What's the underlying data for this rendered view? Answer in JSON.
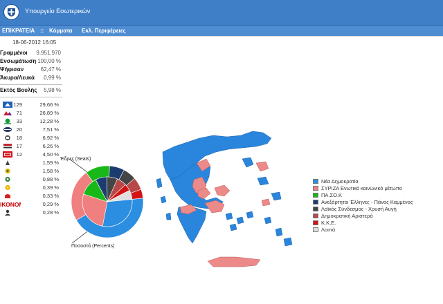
{
  "header": {
    "title": "Υπουργείο Εσωτερικών"
  },
  "nav": {
    "epikrateia": "ΕΠΙΚΡΑΤΕΙΑ",
    "separator": "::",
    "komma": "Κόμματα",
    "perifereies": "Εκλ. Περιφέρειες"
  },
  "timestamp": "18-06-2012 16:05",
  "stats": [
    {
      "label": "Γραμμένοι",
      "value": "9.951.970"
    },
    {
      "label": "Ενσωμάτωση",
      "value": "100,00 %"
    },
    {
      "label": "Ψήφισαν",
      "value": "62,47 %"
    },
    {
      "label": "Άκυρα/Λευκά",
      "value": "0,99 %"
    }
  ],
  "outside": {
    "label": "Εκτός Βουλής",
    "value": "5,98 %"
  },
  "parties": [
    {
      "logo": "nd-logo",
      "seats": "129",
      "pct": "29,66 %",
      "color": "#3b8fd9"
    },
    {
      "logo": "syriza-logo",
      "seats": "71",
      "pct": "26,89 %",
      "color": "#e46f74"
    },
    {
      "logo": "pasok-logo",
      "seats": "33",
      "pct": "12,28 %",
      "color": "#1a9a3a"
    },
    {
      "logo": "anel-logo",
      "seats": "20",
      "pct": "7,51 %",
      "color": "#2a3f6a"
    },
    {
      "logo": "xa-logo",
      "seats": "18",
      "pct": "6,92 %",
      "color": "#444444"
    },
    {
      "logo": "dimar-logo",
      "seats": "17",
      "pct": "6,26 %",
      "color": "#c0272d"
    },
    {
      "logo": "kke-logo",
      "seats": "12",
      "pct": "4,50 %",
      "color": "#d3101b"
    },
    {
      "logo": "party8-logo",
      "seats": "",
      "pct": "1,59 %",
      "color": "#444444"
    },
    {
      "logo": "party9-logo",
      "seats": "",
      "pct": "1,58 %",
      "color": "#e0a800"
    },
    {
      "logo": "party10-logo",
      "seats": "",
      "pct": "0,88 %",
      "color": "#2d7a3a"
    },
    {
      "logo": "party11-logo",
      "seats": "",
      "pct": "0,39 %",
      "color": "#f0b000"
    },
    {
      "logo": "party12-logo",
      "seats": "",
      "pct": "0,33 %",
      "color": "#d62020"
    },
    {
      "logo": "party13-logo",
      "seats": "",
      "pct": "0,29 %",
      "color": "#cc0000"
    },
    {
      "logo": "party14-logo",
      "seats": "",
      "pct": "0,28 %",
      "color": "#333333"
    }
  ],
  "party13_logo_text": "ΙΚΟΝΟΜΙΑ",
  "pie": {
    "seats_label": "Έδρες (Seats)",
    "percent_label": "Ποσοστά (Percents)"
  },
  "legend": [
    {
      "label": "Νέα Δημοκρατία",
      "color": "#2c8ee0"
    },
    {
      "label": "ΣΥΡΙΖΑ Ενωτικό κοινωνικό μέτωπο",
      "color": "#f08080"
    },
    {
      "label": "ΠΑ.ΣΟ.Κ",
      "color": "#18b818"
    },
    {
      "label": "Ανεξάρτητοι Έλληνες - Πάνος Καμμένος",
      "color": "#1c3c70"
    },
    {
      "label": "Λαϊκός Σύνδεσμος - Χρυσή Αυγή",
      "color": "#454545"
    },
    {
      "label": "Δημοκρατική Αριστερά",
      "color": "#b84848"
    },
    {
      "label": "Κ.Κ.Ε.",
      "color": "#d41414"
    },
    {
      "label": "Λοιπά",
      "color": "#e0e0e0"
    }
  ],
  "chart_data": {
    "type": "pie",
    "categories": [
      "Νέα Δημοκρατία",
      "ΣΥΡΙΖΑ Ενωτικό κοινωνικό μέτωπο",
      "ΠΑ.ΣΟ.Κ",
      "Ανεξάρτητοι Έλληνες - Πάνος Καμμένος",
      "Λαϊκός Σύνδεσμος - Χρυσή Αυγή",
      "Δημοκρατική Αριστερά",
      "Κ.Κ.Ε.",
      "Λοιπά"
    ],
    "series": [
      {
        "name": "Έδρες (Seats)",
        "values": [
          129,
          71,
          33,
          20,
          18,
          17,
          12,
          0
        ]
      },
      {
        "name": "Ποσοστά (Percents)",
        "values": [
          29.66,
          26.89,
          12.28,
          7.51,
          6.92,
          6.26,
          4.5,
          5.98
        ]
      }
    ]
  }
}
